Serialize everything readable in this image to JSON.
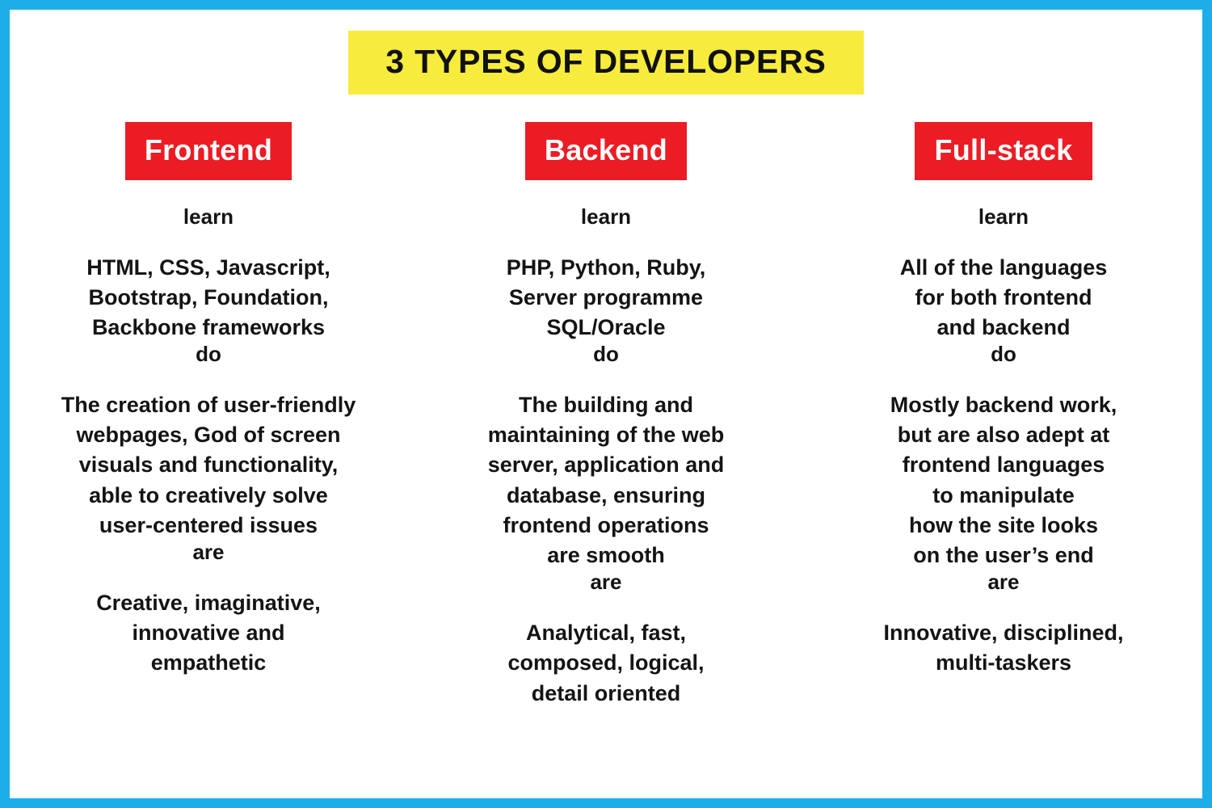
{
  "poster": {
    "title": "3 TYPES OF DEVELOPERS",
    "border_color": "#1CAEE8",
    "title_highlight_color": "#F7EC3D",
    "badge_color": "#EC1C24",
    "text_color": "#141414",
    "background_color": "#FFFFFF"
  },
  "section_labels": {
    "learn": "learn",
    "do": "do",
    "are": "are"
  },
  "columns": [
    {
      "name": "frontend",
      "heading": "Frontend",
      "learn_label": "learn",
      "learn_text": "HTML, CSS, Javascript,\nBootstrap, Foundation,\nBackbone frameworks",
      "do_label": "do",
      "do_text": "The creation of user-friendly\nwebpages, God of screen\nvisuals and functionality,\nable to creatively solve\nuser-centered issues",
      "are_label": "are",
      "are_text": "Creative, imaginative,\ninnovative and\nempathetic"
    },
    {
      "name": "backend",
      "heading": "Backend",
      "learn_label": "learn",
      "learn_text": "PHP, Python, Ruby,\nServer programme\nSQL/Oracle",
      "do_label": "do",
      "do_text": "The building and\nmaintaining of the web\nserver, application and\ndatabase, ensuring\nfrontend operations\nare smooth",
      "are_label": "are",
      "are_text": "Analytical, fast,\ncomposed, logical,\ndetail oriented"
    },
    {
      "name": "full-stack",
      "heading": "Full-stack",
      "learn_label": "learn",
      "learn_text": "All of the languages\nfor both frontend\nand backend",
      "do_label": "do",
      "do_text": "Mostly backend work,\nbut are also adept at\nfrontend languages\nto manipulate\nhow the site looks\non the user’s end",
      "are_label": "are",
      "are_text": "Innovative, disciplined,\nmulti-taskers"
    }
  ]
}
